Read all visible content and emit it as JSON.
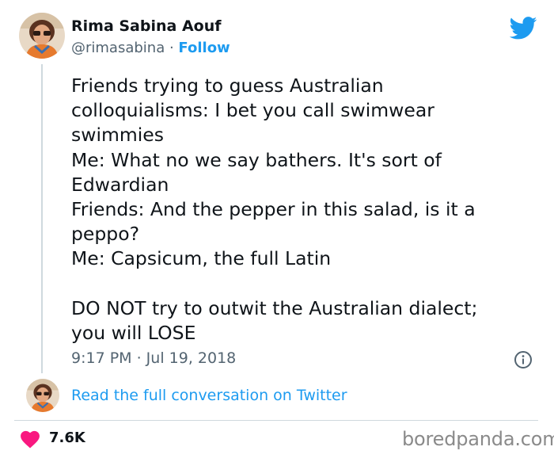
{
  "tweet": {
    "author": {
      "name": "Rima Sabina Aouf",
      "handle": "@rimasabina",
      "separator": " · ",
      "follow_label": "Follow"
    },
    "brand_icon": "twitter-bird-icon",
    "lines": [
      "Friends trying to guess Australian",
      "colloquialisms: I bet you call swimwear",
      "swimmies",
      "Me: What no we say bathers. It's sort of",
      "Edwardian",
      "Friends: And the pepper in this salad, is it a",
      "peppo?",
      "Me: Capsicum, the full Latin",
      "",
      "DO NOT try to outwit the Australian dialect;",
      "you will LOSE"
    ],
    "timestamp": "9:17 PM · Jul 19, 2018",
    "info_icon": "info-icon",
    "read_conversation_label": "Read the full conversation on Twitter",
    "likes": "7.6K",
    "like_icon": "heart-icon"
  },
  "watermark": "boredpanda.com",
  "colors": {
    "text": "#0f1419",
    "secondary": "#536471",
    "accent": "#1d9bf0",
    "heart": "#f91880",
    "divider": "#cfd9de",
    "watermark": "#8a8a8a"
  }
}
